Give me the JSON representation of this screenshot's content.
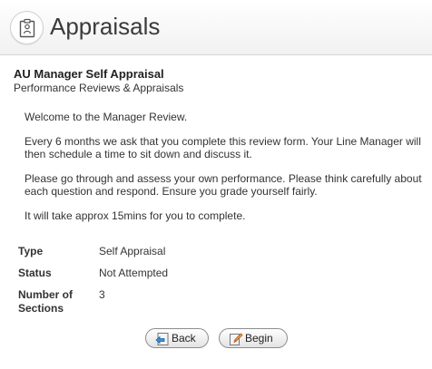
{
  "header": {
    "title": "Appraisals",
    "icon": "clipboard-person-icon"
  },
  "course": {
    "title": "AU Manager Self Appraisal",
    "subtitle": "Performance Reviews & Appraisals"
  },
  "intro": {
    "paragraphs": [
      "Welcome to the Manager Review.",
      "Every 6 months we ask that you complete this review form. Your Line Manager will then schedule a time to sit down and discuss it.",
      "Please go through and assess your own performance. Please think carefully about each question and respond. Ensure you grade yourself fairly.",
      "It will take approx 15mins for you to complete."
    ]
  },
  "details": [
    {
      "label": "Type",
      "value": "Self Appraisal"
    },
    {
      "label": "Status",
      "value": "Not Attempted"
    },
    {
      "label": "Number of Sections",
      "value": "3"
    }
  ],
  "buttons": {
    "back_label": "Back",
    "back_icon": "back-arrow-icon",
    "begin_label": "Begin",
    "begin_icon": "edit-pencil-icon"
  }
}
